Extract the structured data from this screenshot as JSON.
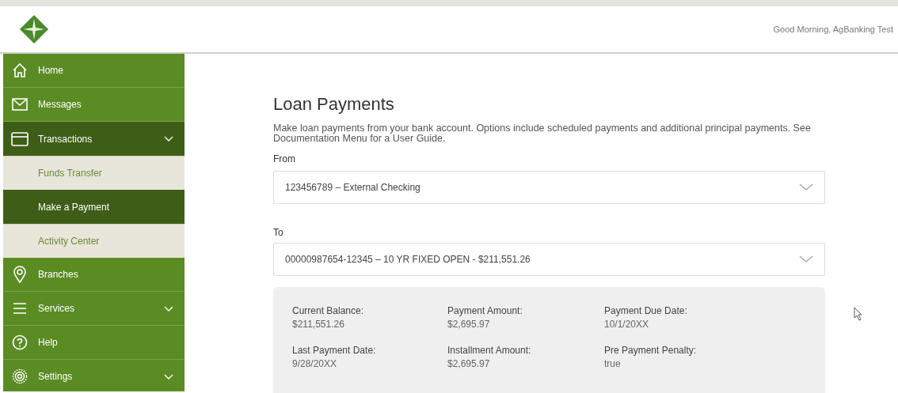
{
  "header": {
    "greeting": "Good Morning, AgBanking Test"
  },
  "sidebar": {
    "items": [
      {
        "label": "Home"
      },
      {
        "label": "Messages"
      },
      {
        "label": "Transactions",
        "expanded": true,
        "children": [
          {
            "label": "Funds Transfer",
            "selected": false
          },
          {
            "label": "Make a Payment",
            "selected": true
          },
          {
            "label": "Activity Center",
            "selected": false
          }
        ]
      },
      {
        "label": "Branches"
      },
      {
        "label": "Services",
        "expanded": false
      },
      {
        "label": "Help"
      },
      {
        "label": "Settings",
        "expanded": false
      }
    ]
  },
  "page": {
    "title": "Loan Payments",
    "description": "Make loan payments from your bank account. Options include scheduled payments and additional principal payments. See Documentation Menu for a User Guide.",
    "from": {
      "label": "From",
      "value": "123456789 – External Checking"
    },
    "to": {
      "label": "To",
      "value": "00000987654-12345 – 10 YR FIXED OPEN - $211,551.26"
    },
    "details": [
      {
        "label": "Current Balance:",
        "value": "$211,551.26"
      },
      {
        "label": "Payment Amount:",
        "value": "$2,695.97"
      },
      {
        "label": "Payment Due Date:",
        "value": "10/1/20XX"
      },
      {
        "label": "Last Payment Date:",
        "value": "9/28/20XX"
      },
      {
        "label": "Installment Amount:",
        "value": "$2,695.97"
      },
      {
        "label": "Pre Payment Penalty:",
        "value": "true"
      }
    ]
  }
}
